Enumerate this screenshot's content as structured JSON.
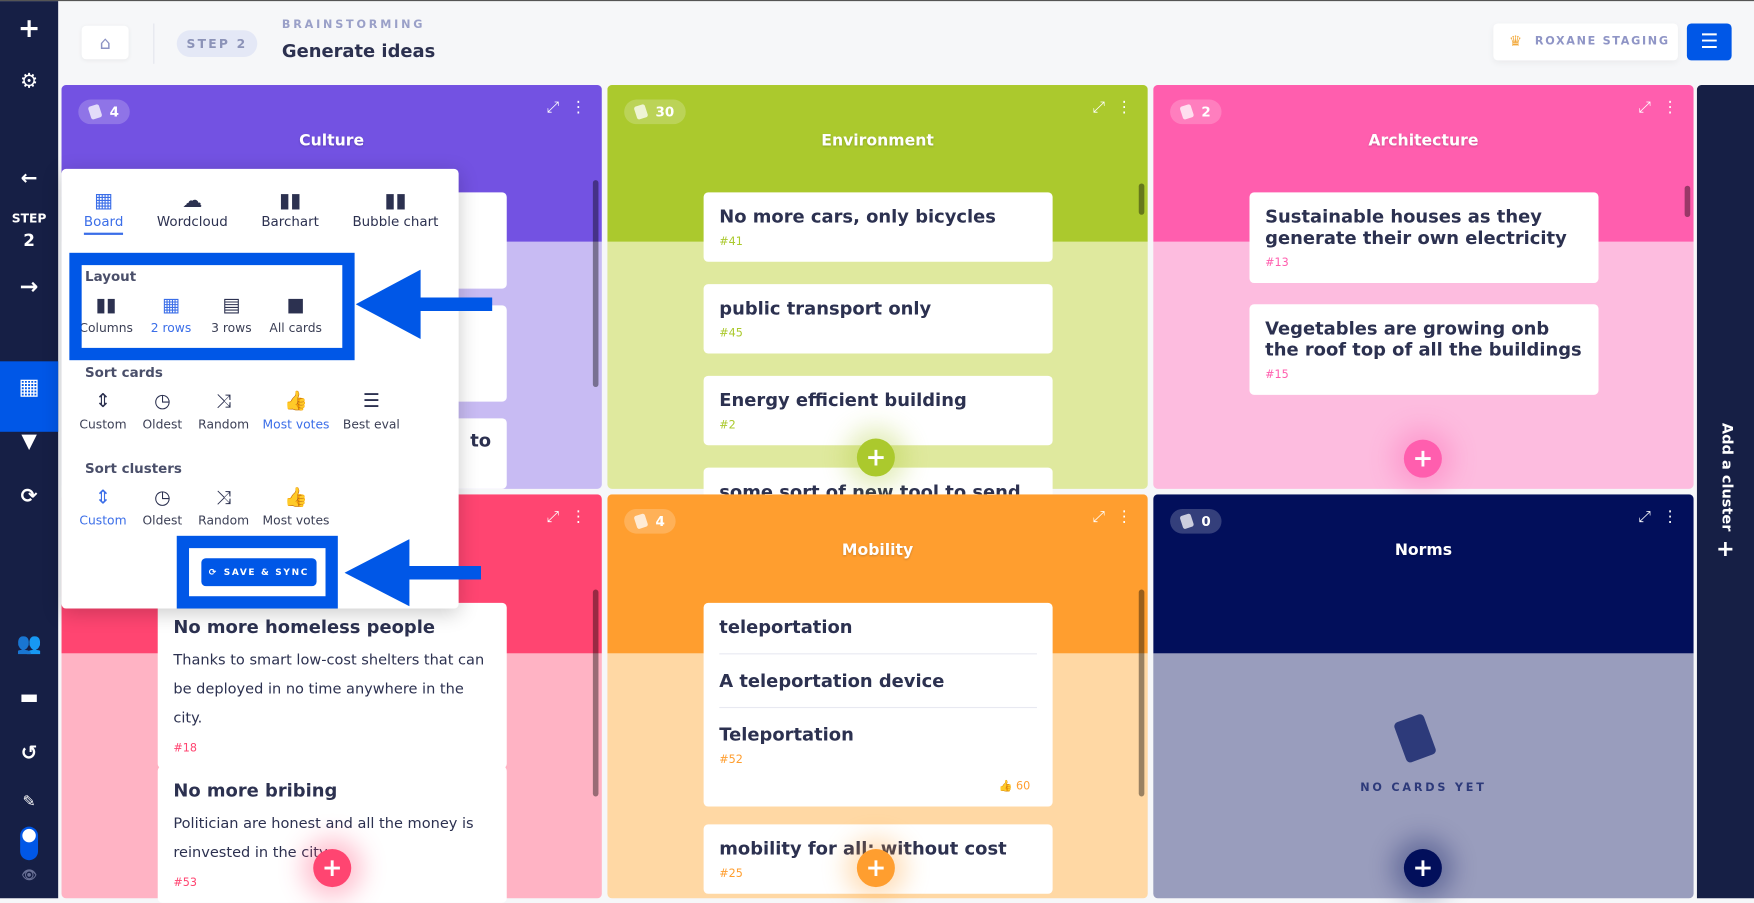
{
  "header": {
    "breadcrumb": "BRAINSTORMING",
    "title": "Generate ideas",
    "step": "STEP 2",
    "org": "ROXANE STAGING"
  },
  "sidebar": {
    "step_label": "STEP",
    "step_number": "2",
    "icons": [
      "plus-icon",
      "gear-icon",
      "arrow-left-icon",
      "arrow-right-icon",
      "board-icon",
      "filter-icon",
      "sync-icon",
      "users-icon",
      "folder-icon",
      "history-icon",
      "pen-icon",
      "toggle",
      "eye-icon"
    ]
  },
  "colors": {
    "accent": "#0057e7",
    "sidebar": "#161f45"
  },
  "clusters": [
    {
      "title": "Culture",
      "count": "4",
      "color": "#7352e2",
      "body": "#c8bbf3",
      "cards": [
        {
          "title": "",
          "id": ""
        },
        {
          "title": "",
          "id": ""
        },
        {
          "title": "to",
          "id": ""
        }
      ]
    },
    {
      "title": "Environment",
      "count": "30",
      "color": "#abc92d",
      "body": "#dfe99e",
      "cards": [
        {
          "title": "No more cars, only bicycles",
          "id": "#41"
        },
        {
          "title": "public transport only",
          "id": "#45"
        },
        {
          "title": "Energy efficient building",
          "id": "#2"
        },
        {
          "title": "some sort of new tool to send me",
          "id": ""
        }
      ]
    },
    {
      "title": "Architecture",
      "count": "2",
      "color": "#ff5eae",
      "body": "#fdbcdf",
      "cards": [
        {
          "title": "Sustainable houses as they generate their own electricity",
          "id": "#13"
        },
        {
          "title": "Vegetables are growing onb the roof top of all the buildings",
          "id": "#15"
        }
      ]
    },
    {
      "title": "",
      "count": "",
      "color": "#ff4571",
      "body": "#ffb3c4",
      "cards": [
        {
          "title": "No more homeless people",
          "desc": "Thanks to smart low-cost shelters that can be deployed in no time anywhere in the city.",
          "id": "#18"
        },
        {
          "title": "No more bribing",
          "desc": "Politician are honest and all the money is reinvested in the city.",
          "id": "#53"
        }
      ]
    },
    {
      "title": "Mobility",
      "count": "4",
      "color": "#ff9e2f",
      "body": "#ffd8a4",
      "cards": [
        {
          "group": [
            "teleportation",
            "A teleportation device",
            "Teleportation"
          ],
          "id": "#52",
          "votes": "60"
        },
        {
          "title": "mobility for all: without cost",
          "id": "#25"
        }
      ]
    },
    {
      "title": "Norms",
      "count": "0",
      "color": "#020f5b",
      "body": "#999dbd",
      "empty": "NO CARDS YET"
    }
  ],
  "add_cluster": "Add a cluster",
  "popup": {
    "views": [
      {
        "label": "Board",
        "icon": "board-icon",
        "active": true
      },
      {
        "label": "Wordcloud",
        "icon": "cloud-icon"
      },
      {
        "label": "Barchart",
        "icon": "barchart-icon"
      },
      {
        "label": "Bubble chart",
        "icon": "bubble-chart-icon"
      }
    ],
    "layout_title": "Layout",
    "layout": [
      {
        "label": "Columns"
      },
      {
        "label": "2 rows",
        "active": true
      },
      {
        "label": "3 rows"
      },
      {
        "label": "All cards"
      }
    ],
    "sort_cards_title": "Sort cards",
    "sort_cards": [
      {
        "label": "Custom"
      },
      {
        "label": "Oldest"
      },
      {
        "label": "Random"
      },
      {
        "label": "Most votes",
        "active": true
      },
      {
        "label": "Best eval"
      }
    ],
    "sort_clusters_title": "Sort clusters",
    "sort_clusters": [
      {
        "label": "Custom",
        "active": true
      },
      {
        "label": "Oldest"
      },
      {
        "label": "Random"
      },
      {
        "label": "Most votes"
      }
    ],
    "save": "SAVE & SYNC"
  }
}
